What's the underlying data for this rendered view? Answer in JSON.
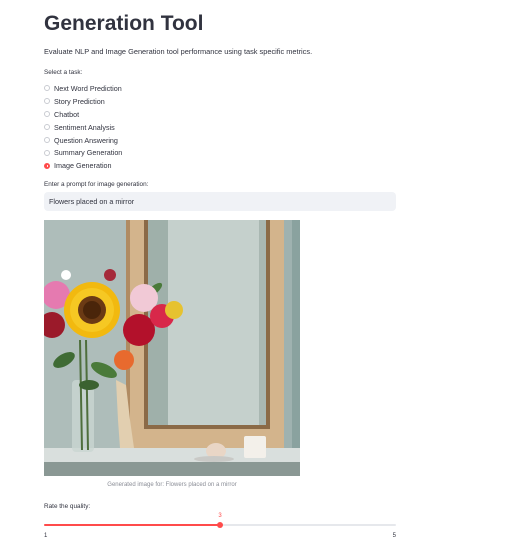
{
  "header": {
    "title": "Generation Tool",
    "subtitle": "Evaluate NLP and Image Generation tool performance using task specific metrics."
  },
  "task_select": {
    "label": "Select a task:",
    "options": [
      {
        "label": "Next Word Prediction",
        "selected": false
      },
      {
        "label": "Story Prediction",
        "selected": false
      },
      {
        "label": "Chatbot",
        "selected": false
      },
      {
        "label": "Sentiment Analysis",
        "selected": false
      },
      {
        "label": "Question Answering",
        "selected": false
      },
      {
        "label": "Summary Generation",
        "selected": false
      },
      {
        "label": "Image Generation",
        "selected": true
      }
    ]
  },
  "prompt": {
    "label": "Enter a prompt for image generation:",
    "value": "Flowers placed on a mirror"
  },
  "image": {
    "caption": "Generated image for: Flowers placed on a mirror"
  },
  "rating": {
    "label": "Rate the quality:",
    "min": 1,
    "max": 5,
    "value": 3
  },
  "colors": {
    "accent": "#ff4b4b",
    "input_bg": "#f0f2f6",
    "text": "#31333f"
  }
}
